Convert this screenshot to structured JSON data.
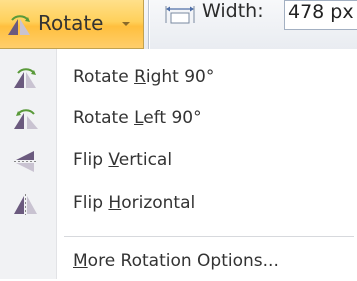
{
  "ribbon": {
    "rotate_button": {
      "label": "Rotate",
      "icon": "rotate-triangle-icon"
    },
    "width": {
      "label": "Width:",
      "value": "478 px",
      "icon": "width-dimension-icon"
    }
  },
  "menu": {
    "items": [
      {
        "pre": "Rotate ",
        "key": "R",
        "post": "ight 90°",
        "icon": "rotate-right-icon"
      },
      {
        "pre": "Rotate ",
        "key": "L",
        "post": "eft 90°",
        "icon": "rotate-left-icon"
      },
      {
        "pre": "Flip ",
        "key": "V",
        "post": "ertical",
        "icon": "flip-vertical-icon"
      },
      {
        "pre": "Flip ",
        "key": "H",
        "post": "orizontal",
        "icon": "flip-horizontal-icon"
      },
      {
        "pre": "",
        "key": "M",
        "post": "ore Rotation Options...",
        "icon": ""
      }
    ]
  },
  "colors": {
    "active_button": "#ffd05a",
    "icon_dark": "#6b5a7e",
    "icon_light": "#c9c3d1",
    "icon_green": "#5a9a3a",
    "text": "#333333"
  }
}
